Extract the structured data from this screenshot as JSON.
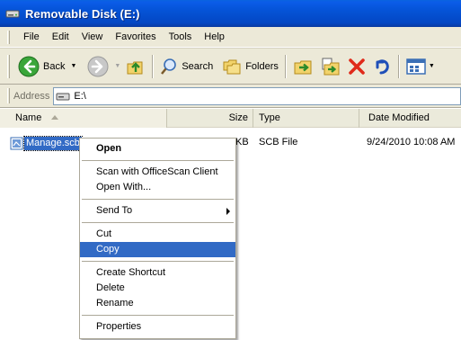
{
  "window": {
    "title": "Removable Disk (E:)",
    "title_icon": "drive-icon"
  },
  "menubar": {
    "items": [
      "File",
      "Edit",
      "View",
      "Favorites",
      "Tools",
      "Help"
    ]
  },
  "toolbar": {
    "back_label": "Back",
    "search_label": "Search",
    "folders_label": "Folders"
  },
  "address": {
    "label": "Address",
    "value": "E:\\"
  },
  "columns": {
    "name": "Name",
    "size": "Size",
    "type": "Type",
    "date": "Date Modified"
  },
  "file": {
    "name": "Manage.scb",
    "size": "KB",
    "type": "SCB File",
    "date": "9/24/2010 10:08 AM"
  },
  "context_menu": {
    "open": "Open",
    "scan": "Scan with OfficeScan Client",
    "open_with": "Open With...",
    "send_to": "Send To",
    "cut": "Cut",
    "copy": "Copy",
    "create_shortcut": "Create Shortcut",
    "delete": "Delete",
    "rename": "Rename",
    "properties": "Properties"
  },
  "colors": {
    "title_blue": "#0553d6",
    "selection": "#316ac5",
    "chrome": "#ece9d8"
  }
}
